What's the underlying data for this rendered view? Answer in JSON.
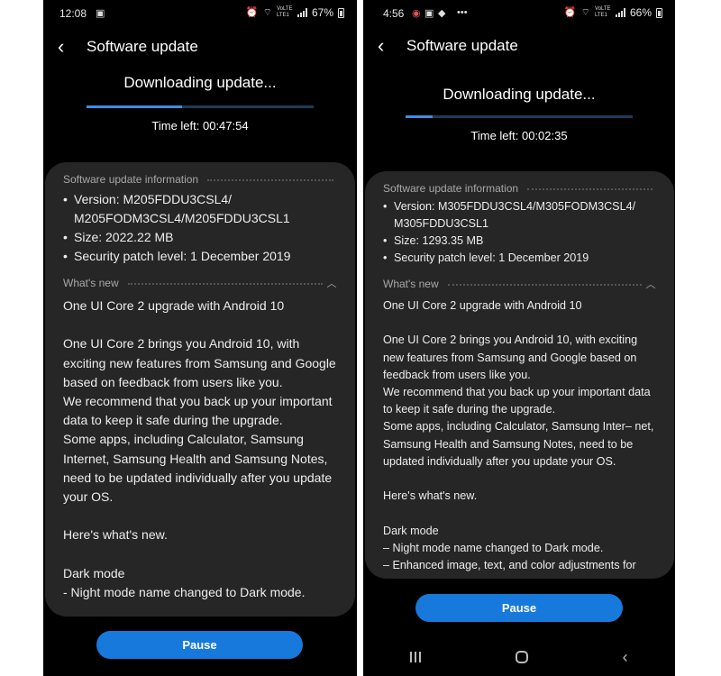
{
  "left": {
    "status": {
      "time": "12:08",
      "battery": "67%",
      "carrier": "VoLTE LTE1"
    },
    "header": {
      "title": "Software update"
    },
    "download": {
      "heading": "Downloading update...",
      "progress": 0.42,
      "time_left": "Time left: 00:47:54"
    },
    "info": {
      "heading": "Software update information",
      "items": [
        {
          "label": "Version: M205FDDU3CSL4/ M205FODM3CSL4/M205FDDU3CSL1"
        },
        {
          "label": "Size: 2022.22 MB"
        },
        {
          "label": "Security patch level: 1 December 2019"
        }
      ]
    },
    "whats_new": {
      "heading": "What's new",
      "body": "One UI Core 2 upgrade with Android 10\n\nOne UI Core 2 brings you Android 10, with exciting new features from Samsung and Google based on feedback from users like you.\nWe recommend that you back up your important data to keep it safe during the upgrade.\nSome apps, including Calculator, Samsung Internet, Samsung Health and Samsung Notes, need to be updated individually after you update your OS.\n\nHere's what's new.\n\nDark mode\n- Night mode name changed to Dark mode."
    },
    "pause_label": "Pause"
  },
  "right": {
    "status": {
      "time": "4:56",
      "battery": "66%",
      "carrier": "VoLTE LTE1"
    },
    "header": {
      "title": "Software update"
    },
    "download": {
      "heading": "Downloading update...",
      "progress": 0.12,
      "time_left": "Time left: 00:02:35"
    },
    "info": {
      "heading": "Software update information",
      "items": [
        {
          "label": "Version: M305FDDU3CSL4/M305FODM3CSL4/ M305FDDU3CSL1"
        },
        {
          "label": "Size: 1293.35 MB"
        },
        {
          "label": "Security patch level: 1 December 2019"
        }
      ]
    },
    "whats_new": {
      "heading": "What's new",
      "body": "One UI Core 2 upgrade with Android 10\n\nOne UI Core 2 brings you Android 10, with exciting new features from Samsung and Google based on feedback from users like you.\nWe recommend that you back up your important data to keep it safe during the upgrade.\nSome apps, including Calculator, Samsung Inter– net, Samsung Health and Samsung Notes, need to be updated individually after you update your OS.\n\nHere's what's new.\n\nDark mode\n– Night mode name changed to Dark mode.\n– Enhanced image, text, and color adjustments for"
    },
    "pause_label": "Pause"
  },
  "icons": [
    "image-icon",
    "alarm-icon",
    "wifi-icon",
    "signal-icon",
    "battery-icon",
    "app-notification-icon",
    "more-icon",
    "back-arrow-icon",
    "chevron-up-icon",
    "recents-icon",
    "home-icon",
    "nav-back-icon"
  ]
}
